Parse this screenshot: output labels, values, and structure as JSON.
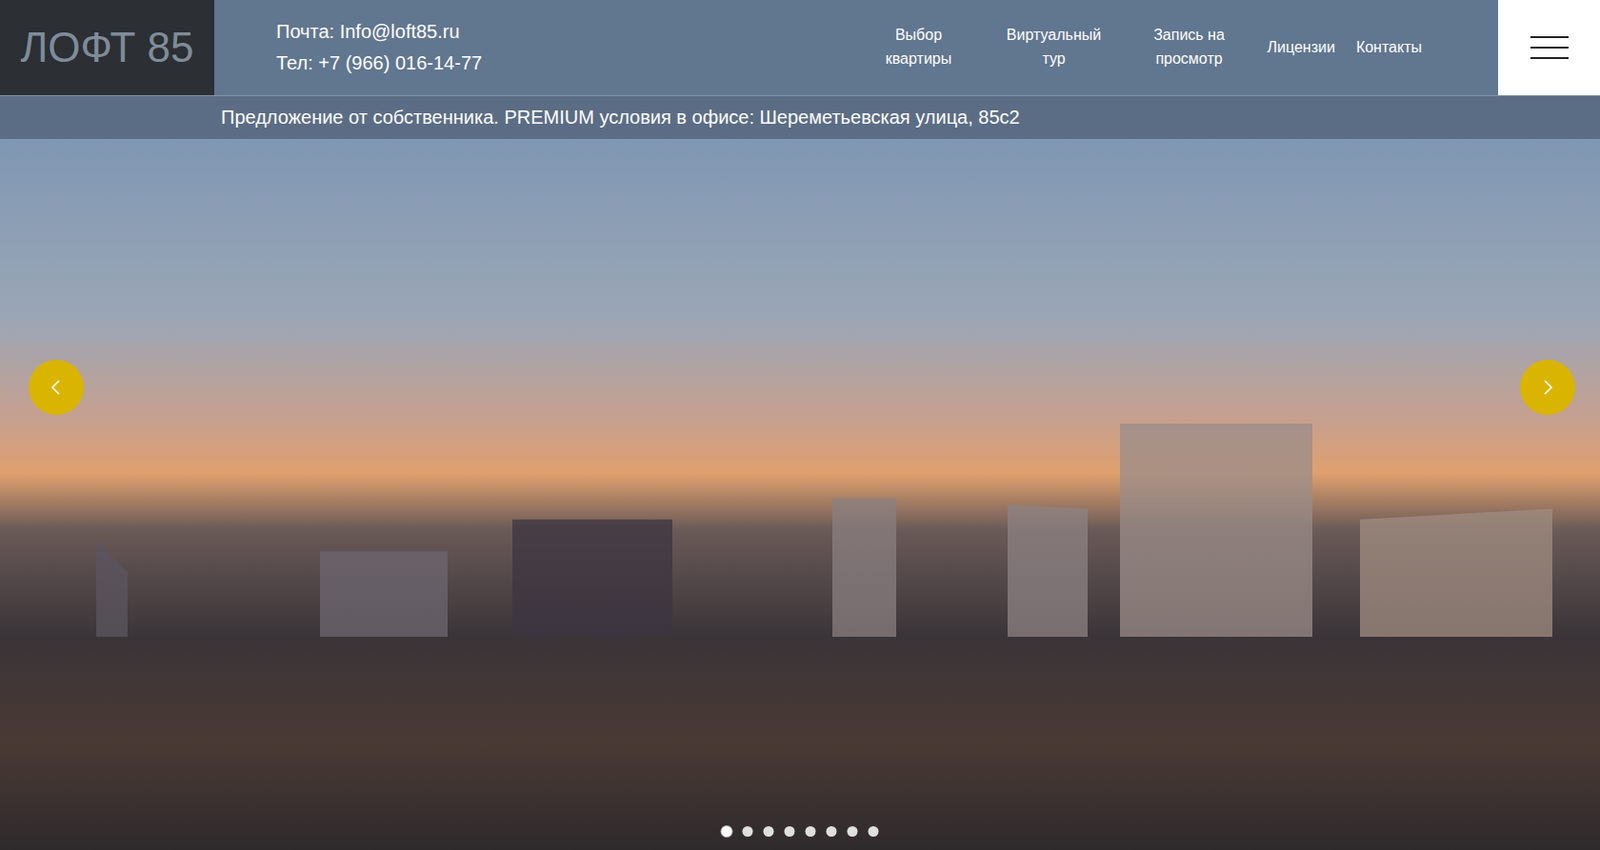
{
  "logo": "ЛОФТ 85",
  "contacts": [
    "Почта: Info@loft85.ru",
    "Тел: +7 (966) 016-14-77"
  ],
  "nav": [
    "Выбор квартиры",
    "Виртуальный тур",
    "Запись на просмотр",
    "Лицензии",
    "Контакты"
  ],
  "banner": "Предложение от собственника. PREMIUM условия в офисе: Шереметьевская улица, 85с2",
  "slider": {
    "slides": [
      {
        "selected": true
      },
      {
        "selected": false
      },
      {
        "selected": false
      },
      {
        "selected": false
      },
      {
        "selected": false
      },
      {
        "selected": false
      },
      {
        "selected": false
      },
      {
        "selected": false
      }
    ]
  }
}
